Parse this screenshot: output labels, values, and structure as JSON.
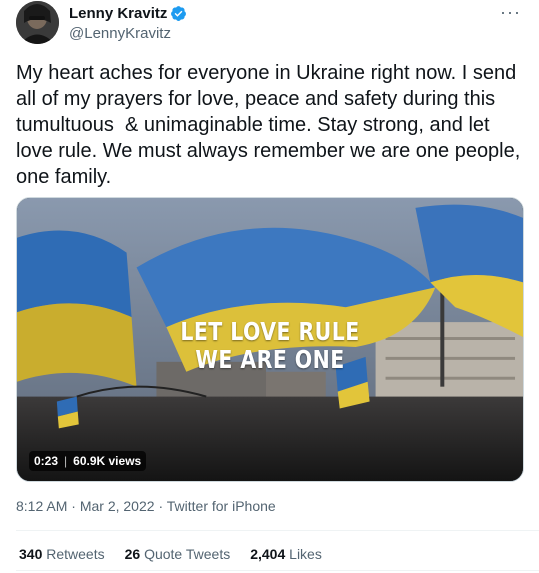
{
  "author": {
    "name": "Lenny Kravitz",
    "handle": "@LennyKravitz",
    "verified_color": "#1d9bf0"
  },
  "tweet": {
    "text": "My heart aches for everyone in Ukraine right now. I send all of my prayers for love, peace and safety during this tumultuous  & unimaginable time. Stay strong, and let love rule. We must always remember we are one people, one family.",
    "media": {
      "overlay_line1": "LET LOVE RULE",
      "overlay_line2": "WE ARE ONE",
      "duration": "0:23",
      "views": "60.9K views"
    },
    "time": "8:12 AM",
    "date": "Mar 2, 2022",
    "source": "Twitter for iPhone",
    "separator": "·"
  },
  "stats": {
    "retweets_count": "340",
    "retweets_label": "Retweets",
    "quotes_count": "26",
    "quotes_label": "Quote Tweets",
    "likes_count": "2,404",
    "likes_label": "Likes"
  },
  "icons": {
    "more": "more-options-icon",
    "verified": "verified-badge-icon"
  },
  "colors": {
    "flag_blue": "#2f6cb5",
    "flag_yellow": "#e2c53a",
    "secondary_text": "#536471"
  }
}
